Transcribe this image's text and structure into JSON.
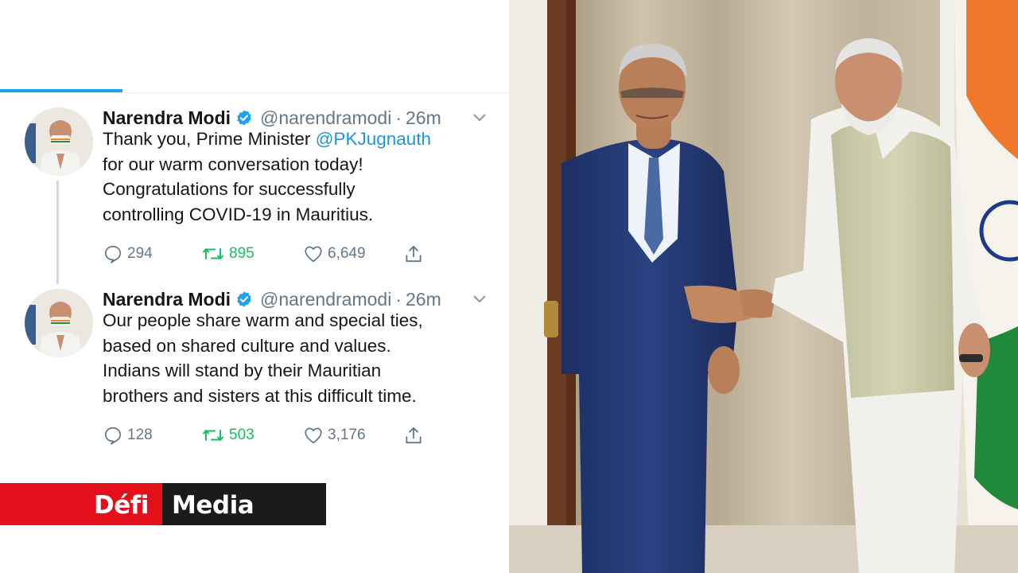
{
  "tweets": [
    {
      "name": "Narendra Modi",
      "handle": "@narendramodi",
      "separator": "·",
      "time": "26m",
      "body_lines": [
        [
          "Thank you, Prime Minister ",
          "@PKJugnauth"
        ],
        [
          "for our warm conversation today!",
          ""
        ],
        [
          "Congratulations for successfully",
          ""
        ],
        [
          "controlling COVID-19 in Mauritius.",
          ""
        ]
      ],
      "replies": "294",
      "retweets": "895",
      "likes": "6,649"
    },
    {
      "name": "Narendra Modi",
      "handle": "@narendramodi",
      "separator": "·",
      "time": "26m",
      "body_lines": [
        [
          "Our people share warm and special ties,",
          ""
        ],
        [
          "based on shared culture and values.",
          ""
        ],
        [
          "Indians will stand by their Mauritian",
          ""
        ],
        [
          "brothers and sisters at this difficult time.",
          ""
        ]
      ],
      "replies": "128",
      "retweets": "503",
      "likes": "3,176"
    }
  ],
  "logo": {
    "part1": "Défi",
    "part2": "Media"
  },
  "colors": {
    "twitter_blue": "#1da1f2",
    "mention": "#1b95e0",
    "retweet_green": "#17bf63",
    "muted": "#657786",
    "logo_red": "#e3101b",
    "logo_dark": "#1b1b1b"
  },
  "icons": [
    "verified-icon",
    "chevron-down-icon",
    "reply-icon",
    "retweet-icon",
    "like-icon",
    "share-icon"
  ]
}
